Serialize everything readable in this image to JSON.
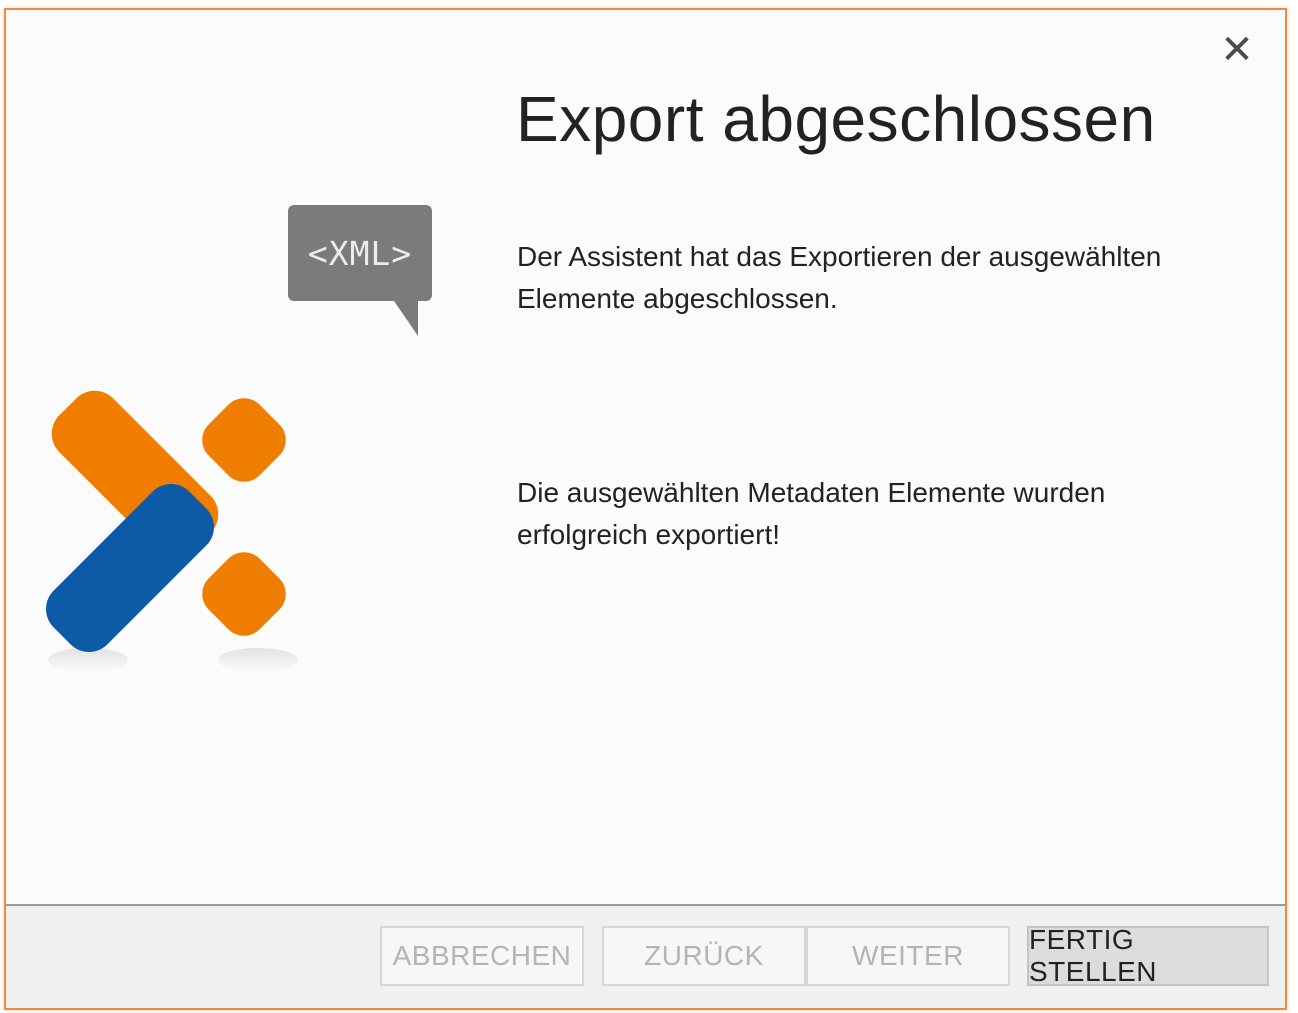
{
  "dialog": {
    "title": "Export abgeschlossen",
    "message_1": "Der Assistent hat das Exportieren der ausgewählten Elemente abgeschlossen.",
    "message_2": "Die ausgewählten Metadaten Elemente wurden erfolgreich exportiert!",
    "close_glyph": "✕",
    "xml_badge": "<XML>"
  },
  "buttons": {
    "cancel": "ABBRECHEN",
    "back": "ZURÜCK",
    "next": "WEITER",
    "finish": "FERTIG STELLEN"
  },
  "colors": {
    "accent_orange": "#ef7d00",
    "accent_blue": "#0d5aa7",
    "border_orange": "#f08a3c",
    "badge_gray": "#7b7b7b"
  },
  "icons": {
    "close": "close-icon",
    "xml": "xml-speech-bubble-icon",
    "logo": "x-logo-icon"
  }
}
